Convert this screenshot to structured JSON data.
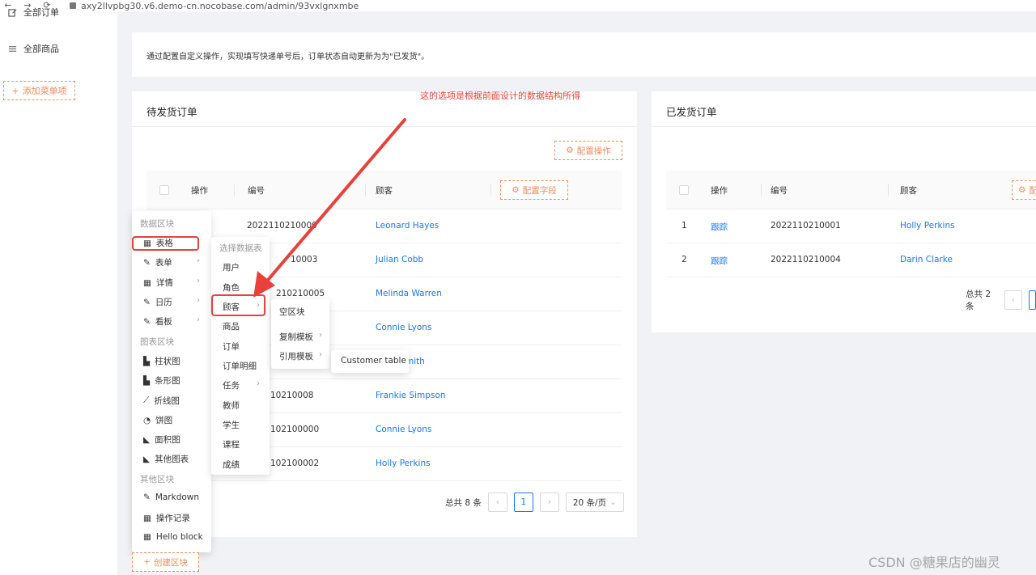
{
  "browser": {
    "url": "axy2llvpbg30.v6.demo-cn.nocobase.com/admin/93vxlgnxmbe",
    "back": "←",
    "forward": "→",
    "reload": "⟳"
  },
  "sidebar": {
    "items": [
      {
        "label": "全部订单",
        "icon": "edit-icon"
      },
      {
        "label": "全部商品",
        "icon": "list-icon"
      }
    ],
    "add_menu_label": "添加菜单项"
  },
  "description": "通过配置自定义操作，实现填写快递单号后，订单状态自动更新为为\"已发货\"。",
  "annotation": "这的选项是根据前面设计的数据结构所得",
  "pending_card": {
    "title": "待发货订单",
    "config_action_label": "配置操作",
    "config_field_label": "配置字段",
    "columns": [
      "操作",
      "编号",
      "顾客"
    ],
    "rows": [
      {
        "number": "2022110210000",
        "customer": "Leonard Hayes"
      },
      {
        "number": "10003",
        "customer": "Julian Cobb"
      },
      {
        "number": "210210005",
        "customer": "Melinda Warren"
      },
      {
        "number": "",
        "customer": "Connie Lyons"
      },
      {
        "number": "",
        "customer": "mith"
      },
      {
        "number": "10210008",
        "customer": "Frankie Simpson"
      },
      {
        "number": "102100000",
        "customer": "Connie Lyons"
      },
      {
        "number": "102100002",
        "customer": "Holly Perkins"
      }
    ],
    "pager": {
      "total": "总共 8 条",
      "current": "1",
      "size": "20 条/页"
    }
  },
  "shipped_card": {
    "title": "已发货订单",
    "config_field_label": "配",
    "columns": [
      "操作",
      "编号",
      "顾客"
    ],
    "rows": [
      {
        "index": "1",
        "action": "跟踪",
        "number": "2022110210001",
        "customer": "Holly Perkins"
      },
      {
        "index": "2",
        "action": "跟踪",
        "number": "2022110210004",
        "customer": "Darin Clarke"
      }
    ],
    "pager": {
      "total": "总共 2 条"
    }
  },
  "block_menu": {
    "data_group": "数据区块",
    "data_items": [
      "表格",
      "表单",
      "详情",
      "日历",
      "看板"
    ],
    "chart_group": "图表区块",
    "chart_items": [
      "柱状图",
      "条形图",
      "折线图",
      "饼图",
      "面积图",
      "其他图表"
    ],
    "other_group": "其他区块",
    "other_items": [
      "Markdown",
      "操作记录",
      "Hello block"
    ]
  },
  "table_menu": {
    "title": "选择数据表",
    "items": [
      "用户",
      "角色",
      "顾客",
      "商品",
      "订单",
      "订单明细",
      "任务",
      "教师",
      "学生",
      "课程",
      "成绩"
    ]
  },
  "customer_menu": {
    "items": [
      "空区块",
      "复制模板",
      "引用模板"
    ]
  },
  "template_menu": {
    "items": [
      "Customer table"
    ]
  },
  "create_block_label": "创建区块",
  "watermark": "CSDN @糖果店的幽灵",
  "colors": {
    "accent": "#f08b5a",
    "link": "#1677ff",
    "annotation": "#e8403a"
  }
}
